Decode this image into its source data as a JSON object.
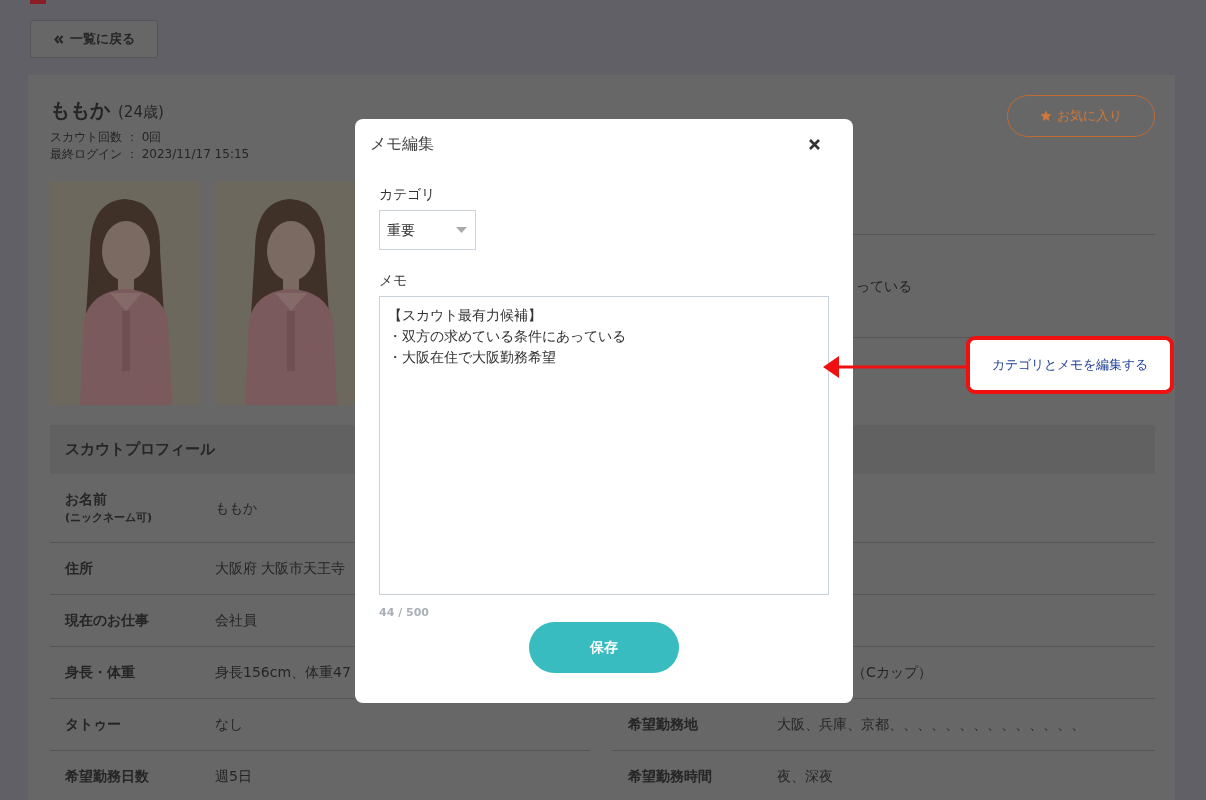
{
  "back_button": {
    "label": "一覧に戻る"
  },
  "profile": {
    "name": "ももか",
    "age": "(24歳)",
    "scout_count": "スカウト回数 ： 0回",
    "last_login": "最終ログイン ： 2023/11/17 15:15",
    "favorite_button": "お気に入り"
  },
  "memo_preview": "っている",
  "section_title": "スカウトプロフィール",
  "left_rows": [
    {
      "label": "お名前",
      "sublabel": "(ニックネーム可)",
      "value": "ももか"
    },
    {
      "label": "住所",
      "value": "大阪府 大阪市天王寺"
    },
    {
      "label": "現在のお仕事",
      "value": "会社員"
    },
    {
      "label": "身長・体重",
      "value": "身長156cm、体重47"
    },
    {
      "label": "タトゥー",
      "value": "なし"
    },
    {
      "label": "希望勤務日数",
      "value": "週5日"
    }
  ],
  "right_rows": [
    {
      "kind": "covered"
    },
    {
      "kind": "covered"
    },
    {
      "kind": "covered"
    },
    {
      "kind": "partial",
      "value": "（Cカップ）"
    },
    {
      "kind": "full",
      "label": "希望勤務地",
      "value": "大阪、兵庫、京都、、、、、、、、、、、、、、"
    },
    {
      "kind": "full",
      "label": "希望勤務時間",
      "value": "夜、深夜"
    }
  ],
  "modal": {
    "title": "メモ編集",
    "category_label": "カテゴリ",
    "category_value": "重要",
    "memo_label": "メモ",
    "memo_lines": [
      "【スカウト最有力候補】",
      "・双方の求めている条件にあっている",
      "・大阪在住で大阪勤務希望"
    ],
    "counter": "44 / 500",
    "save_button": "保存"
  },
  "callout": {
    "text": "カテゴリとメモを編集する"
  }
}
